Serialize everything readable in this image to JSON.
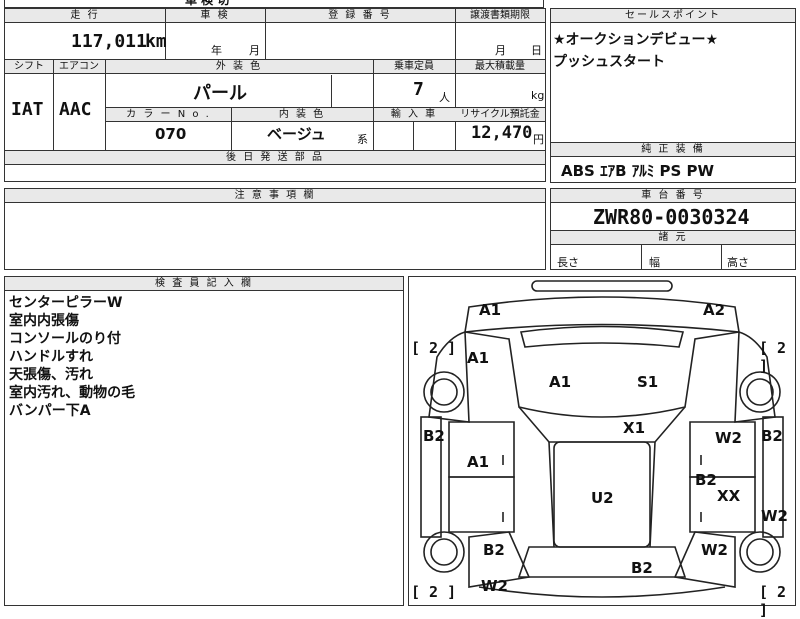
{
  "top_partial": {
    "text": "車 検 切"
  },
  "mileage": {
    "header": "走 行",
    "value": "117,011",
    "unit": "km"
  },
  "inspection": {
    "header": "車 検",
    "year": "年",
    "month": "月"
  },
  "registration": {
    "header": "登 録 番 号"
  },
  "transfer": {
    "header": "譲渡書類期限",
    "month": "月",
    "day": "日"
  },
  "shift": {
    "header": "シフト",
    "value": "IAT"
  },
  "aircon": {
    "header": "エアコン",
    "value": "AAC"
  },
  "exterior_color": {
    "header": "外 装 色",
    "value": "パール"
  },
  "capacity": {
    "header": "乗車定員",
    "value": "7",
    "unit": "人"
  },
  "max_load": {
    "header": "最大積載量",
    "unit": "kg"
  },
  "color_no": {
    "header": "カ ラ ー N o .",
    "value": "070"
  },
  "interior_color": {
    "header": "内 装 色",
    "value": "ベージュ",
    "suffix": "系"
  },
  "import": {
    "header": "輸 入 車"
  },
  "recycle": {
    "header": "リサイクル預託金",
    "value": "12,470",
    "unit": "円"
  },
  "later_parts": {
    "header": "後 日 発 送 部 品"
  },
  "sales_points": {
    "header": "セールスポイント",
    "lines": [
      "★オークションデビュー★",
      "プッシュスタート"
    ]
  },
  "genuine": {
    "header": "純 正 装 備",
    "value": "ABS ｴｱB ｱﾙﾐ PS PW"
  },
  "caution": {
    "header": "注 意 事 項 欄"
  },
  "chassis": {
    "header": "車 台 番 号",
    "value": "ZWR80-0030324"
  },
  "specs": {
    "header": "諸 元",
    "length": "長さ",
    "width": "幅",
    "height": "高さ"
  },
  "inspector": {
    "header": "検 査 員 記 入 欄",
    "lines": [
      "センターピラーW",
      "室内内張傷",
      "コンソールのり付",
      "ハンドルすれ",
      "天張傷、汚れ",
      "室内汚れ、動物の毛",
      "バンパー下A"
    ]
  },
  "diagram": {
    "marks": {
      "a1_front_left": "A1",
      "a2_front_right": "A2",
      "bracket_left": "[ 2 ]",
      "bracket_right": "[ 2 ]",
      "a1_hood_left": "A1",
      "a1_hood": "A1",
      "s1_hood": "S1",
      "b2_left_side": "B2",
      "b2_right_side": "B2",
      "x1_roof": "X1",
      "w2_right_door": "W2",
      "a1_left_door": "A1",
      "b2_right_door": "B2",
      "xx_right": "XX",
      "u2_roof": "U2",
      "w2_right_rear": "W2",
      "b2_left_rear": "B2",
      "w2_right_bottom": "W2",
      "b2_trunk": "B2",
      "w2_left_bottom": "W2",
      "bracket_bl": "[ 2 ]",
      "bracket_br": "[ 2 ]"
    }
  }
}
